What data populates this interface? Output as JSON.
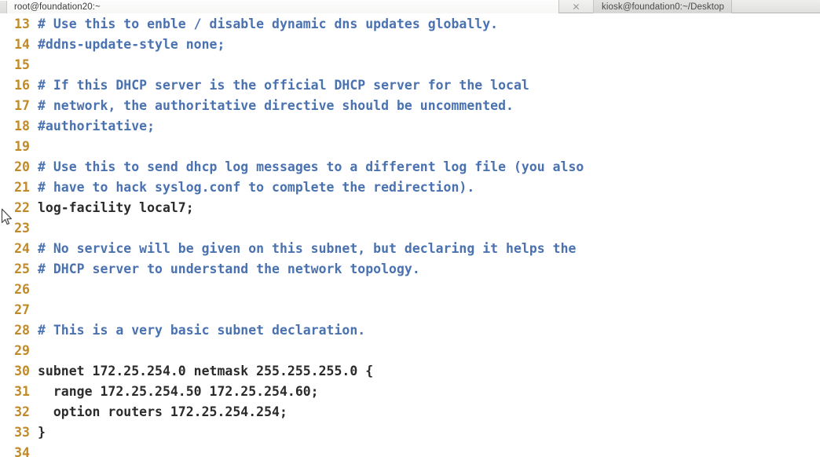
{
  "window": {
    "title": "root@foundation20:~",
    "tabs": [
      {
        "label": "root@foundation20:~",
        "active": true
      },
      {
        "label": "kiosk@foundation0:~/Desktop",
        "active": false
      }
    ],
    "close_icon": "close-icon"
  },
  "colors": {
    "line_number": "#c08a28",
    "comment": "#4a72b0",
    "code": "#2b2b2b",
    "background": "#ffffff",
    "tabbar_bg": "#ececeb"
  },
  "editor": {
    "first_visible_line": 13,
    "last_visible_line": 34,
    "lines": [
      {
        "num": "13",
        "text": "# Use this to enble / disable dynamic dns updates globally.",
        "kind": "comment"
      },
      {
        "num": "14",
        "text": "#ddns-update-style none;",
        "kind": "comment"
      },
      {
        "num": "15",
        "text": "",
        "kind": "comment"
      },
      {
        "num": "16",
        "text": "# If this DHCP server is the official DHCP server for the local",
        "kind": "comment"
      },
      {
        "num": "17",
        "text": "# network, the authoritative directive should be uncommented.",
        "kind": "comment"
      },
      {
        "num": "18",
        "text": "#authoritative;",
        "kind": "comment"
      },
      {
        "num": "19",
        "text": "",
        "kind": "comment"
      },
      {
        "num": "20",
        "text": "# Use this to send dhcp log messages to a different log file (you also",
        "kind": "comment"
      },
      {
        "num": "21",
        "text": "# have to hack syslog.conf to complete the redirection).",
        "kind": "comment"
      },
      {
        "num": "22",
        "text": "log-facility local7;",
        "kind": "code"
      },
      {
        "num": "23",
        "text": "",
        "kind": "code"
      },
      {
        "num": "24",
        "text": "# No service will be given on this subnet, but declaring it helps the",
        "kind": "comment"
      },
      {
        "num": "25",
        "text": "# DHCP server to understand the network topology.",
        "kind": "comment"
      },
      {
        "num": "26",
        "text": "",
        "kind": "code"
      },
      {
        "num": "27",
        "text": "",
        "kind": "code"
      },
      {
        "num": "28",
        "text": "# This is a very basic subnet declaration.",
        "kind": "comment"
      },
      {
        "num": "29",
        "text": "",
        "kind": "code"
      },
      {
        "num": "30",
        "text": "subnet 172.25.254.0 netmask 255.255.255.0 {",
        "kind": "code"
      },
      {
        "num": "31",
        "text": "  range 172.25.254.50 172.25.254.60;",
        "kind": "code"
      },
      {
        "num": "32",
        "text": "  option routers 172.25.254.254;",
        "kind": "code"
      },
      {
        "num": "33",
        "text": "}",
        "kind": "code"
      },
      {
        "num": "34",
        "text": "",
        "kind": "code"
      }
    ]
  }
}
